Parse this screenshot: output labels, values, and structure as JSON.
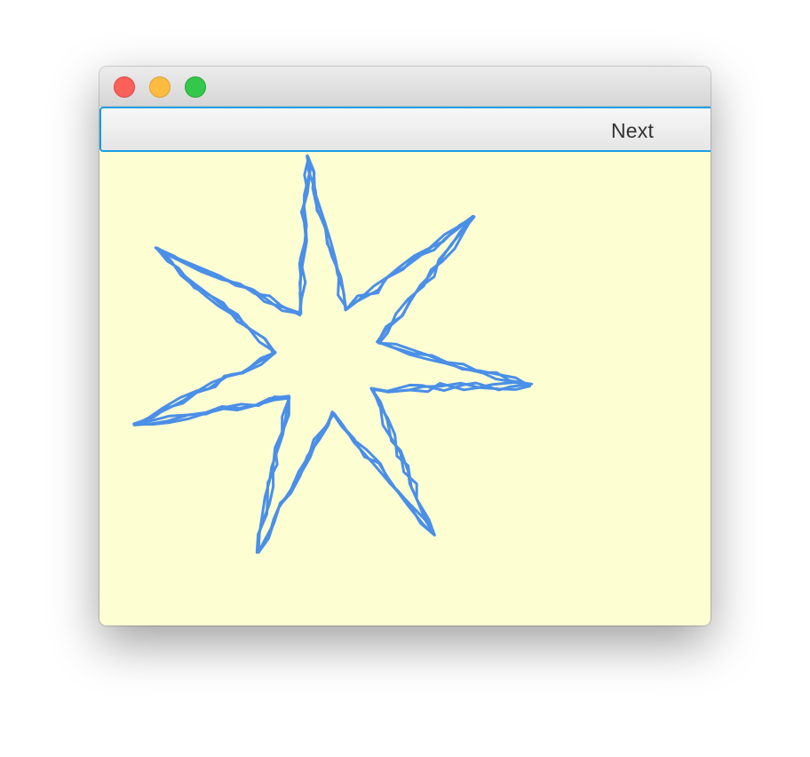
{
  "window": {
    "controls": [
      "close-button",
      "minimize-button",
      "zoom-button"
    ],
    "colors": {
      "close": "#fc605b",
      "minimize": "#fdbc40",
      "zoom": "#34c84a",
      "background": "#fefed3",
      "stroke": "#4a8fe8",
      "focus_ring": "#1a9ee6"
    }
  },
  "toolbar": {
    "next_label": "Next"
  },
  "drawing": {
    "shape": "seven-point-star",
    "points": 7,
    "strokes": 3
  }
}
